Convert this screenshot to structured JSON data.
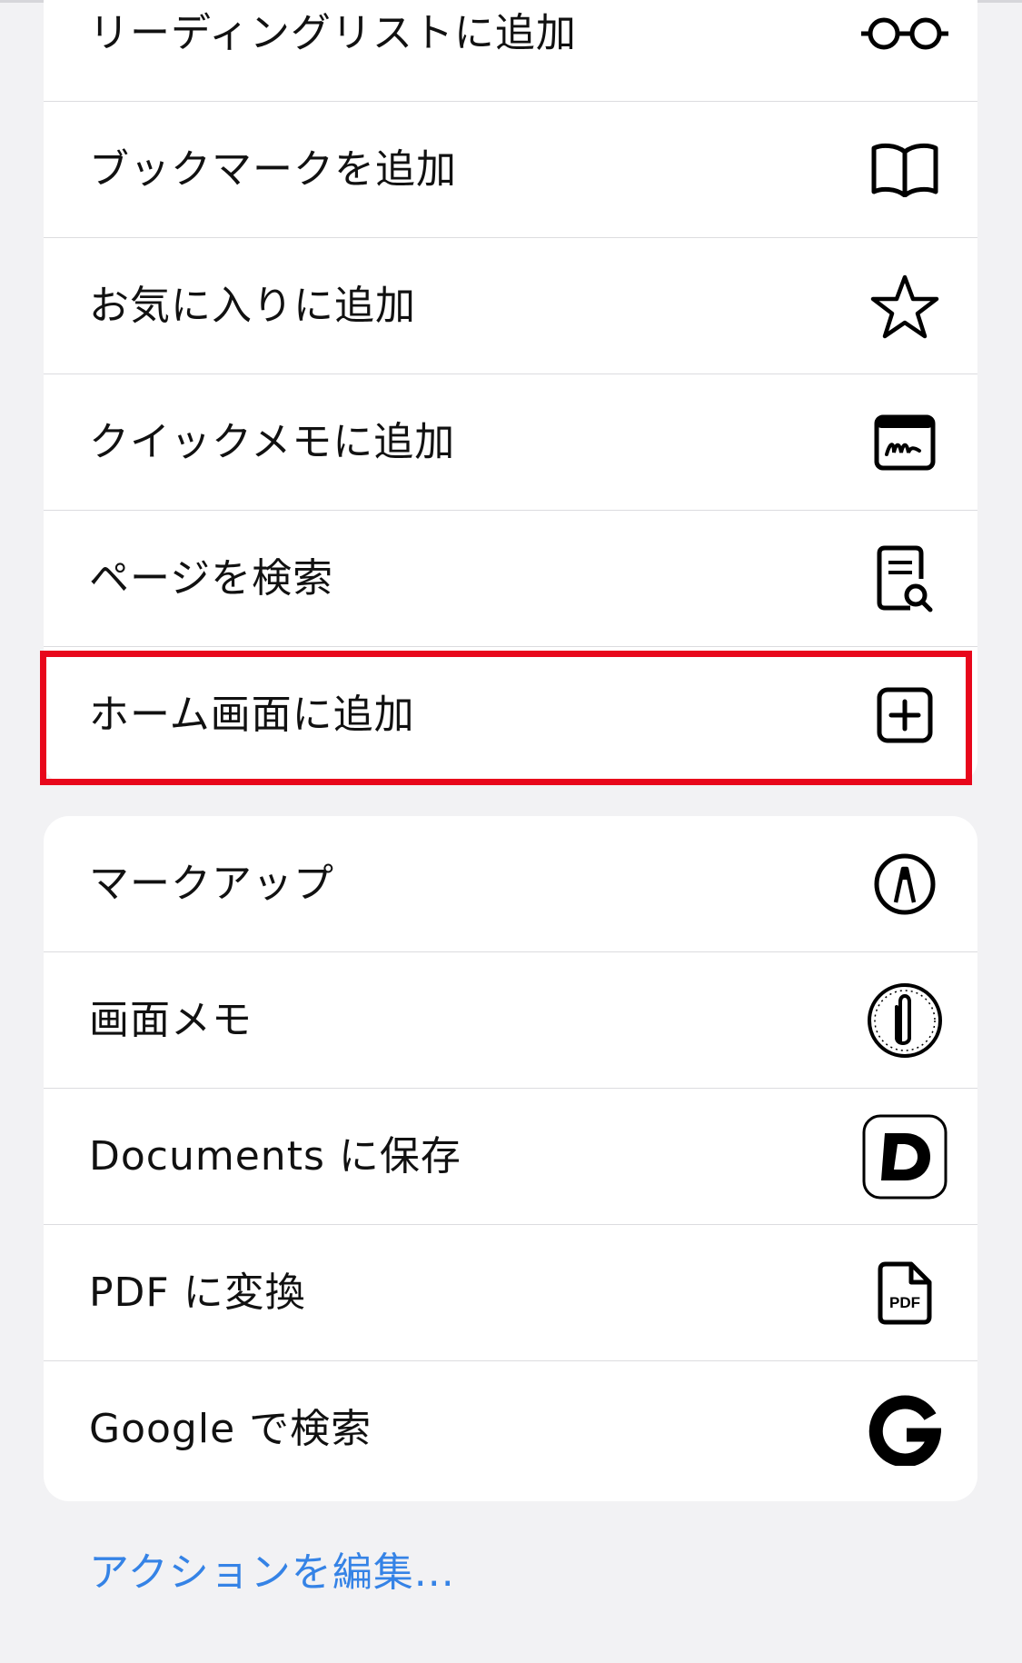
{
  "menu": {
    "group1": [
      {
        "label": "リーディングリストに追加",
        "icon": "glasses-icon"
      },
      {
        "label": "ブックマークを追加",
        "icon": "book-icon"
      },
      {
        "label": "お気に入りに追加",
        "icon": "star-icon"
      },
      {
        "label": "クイックメモに追加",
        "icon": "quick-note-icon"
      },
      {
        "label": "ページを検索",
        "icon": "doc-search-icon"
      },
      {
        "label": "ホーム画面に追加",
        "icon": "plus-square-icon",
        "highlighted": true
      }
    ],
    "group2": [
      {
        "label": "マークアップ",
        "icon": "markup-pen-icon"
      },
      {
        "label": "画面メモ",
        "icon": "paperclip-dial-icon"
      },
      {
        "label": "Documents に保存",
        "icon": "documents-app-icon",
        "icon_text": "D"
      },
      {
        "label": "PDF に変換",
        "icon": "pdf-file-icon",
        "icon_text": "PDF"
      },
      {
        "label": "Google で検索",
        "icon": "google-g-icon"
      }
    ]
  },
  "edit_actions_label": "アクションを編集...",
  "colors": {
    "background": "#f2f2f4",
    "card": "#ffffff",
    "highlight_border": "#e8071b",
    "link": "#3583e6",
    "text": "#111111"
  }
}
